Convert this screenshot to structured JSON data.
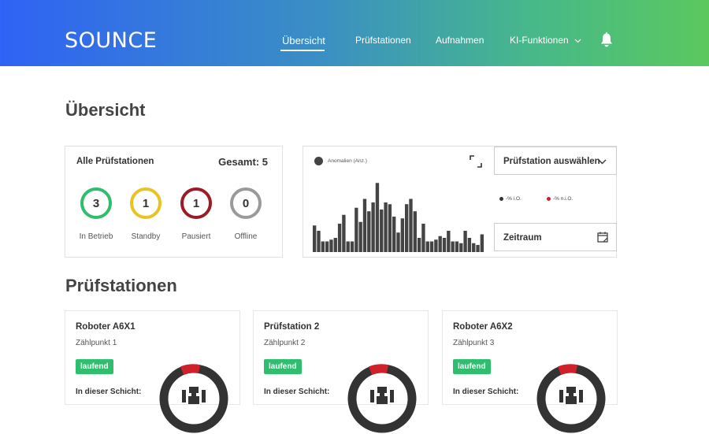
{
  "header": {
    "brand": "SOUNCE",
    "nav": [
      {
        "label": "Übersicht",
        "active": true
      },
      {
        "label": "Prüfstationen"
      },
      {
        "label": "Aufnahmen"
      },
      {
        "label": "KI-Funktionen"
      }
    ]
  },
  "page_title": "Übersicht",
  "summary": {
    "title": "Alle Prüfstationen",
    "total": "Gesamt: 5",
    "stats": [
      {
        "value": "3",
        "label": "In Betrieb",
        "color": "#2fbe6e"
      },
      {
        "value": "1",
        "label": "Standby",
        "color": "#e8c321"
      },
      {
        "value": "1",
        "label": "Pausiert",
        "color": "#9b1c24"
      },
      {
        "value": "0",
        "label": "Offline",
        "color": "#9a9a9a"
      }
    ]
  },
  "chart_panel": {
    "legend": "Anomalien (Anz.)",
    "station_select": "Prüfstation auswählen",
    "legend_io": "-% i.O.",
    "legend_nio": "-% n.i.O.",
    "color_io": "#333333",
    "color_nio": "#d0202a",
    "timerange": "Zeitraum"
  },
  "chart_data": {
    "type": "bar",
    "title": "",
    "legend": "Anomalien (Anz.)",
    "values": [
      30,
      24,
      12,
      12,
      14,
      16,
      32,
      42,
      12,
      12,
      50,
      34,
      60,
      46,
      56,
      78,
      48,
      56,
      54,
      40,
      22,
      38,
      54,
      60,
      46,
      16,
      32,
      12,
      12,
      14,
      18,
      16,
      24,
      12,
      12,
      10,
      24,
      16,
      10,
      8,
      20
    ],
    "ylim": [
      0,
      80
    ]
  },
  "stations_title": "Prüfstationen",
  "stations": [
    {
      "name": "Roboter A6X1",
      "subtitle": "Zählpunkt 1",
      "status": "laufend",
      "shift_label": "In dieser Schicht:"
    },
    {
      "name": "Prüfstation 2",
      "subtitle": "Zählpunkt 2",
      "status": "laufend",
      "shift_label": "In dieser Schicht:"
    },
    {
      "name": "Roboter A6X2",
      "subtitle": "Zählpunkt 3",
      "status": "laufend",
      "shift_label": "In dieser Schicht:"
    }
  ]
}
